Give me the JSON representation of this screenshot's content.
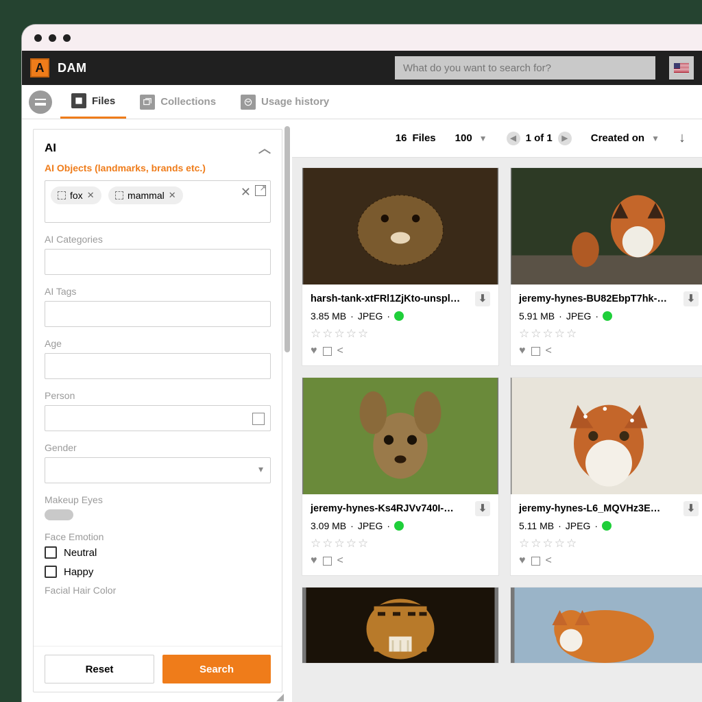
{
  "app": {
    "title": "DAM"
  },
  "search": {
    "placeholder": "What do you want to search for?"
  },
  "tabs": {
    "files": "Files",
    "collections": "Collections",
    "usage": "Usage history"
  },
  "sidebar": {
    "panel_title": "AI",
    "section_title": "AI Objects (landmarks, brands etc.)",
    "chips": [
      {
        "label": "fox"
      },
      {
        "label": "mammal"
      }
    ],
    "labels": {
      "ai_categories": "AI Categories",
      "ai_tags": "AI Tags",
      "age": "Age",
      "person": "Person",
      "gender": "Gender",
      "makeup_eyes": "Makeup Eyes",
      "face_emotion": "Face Emotion",
      "facial_hair": "Facial Hair Color"
    },
    "emotions": {
      "neutral": "Neutral",
      "happy": "Happy"
    },
    "buttons": {
      "reset": "Reset",
      "search": "Search"
    }
  },
  "topbar": {
    "count": "16",
    "count_label": "Files",
    "page_size": "100",
    "pager": "1 of 1",
    "sort": "Created on"
  },
  "files": [
    {
      "name": "harsh-tank-xtFRl1ZjKto-unspl…",
      "size": "3.85 MB",
      "type": "JPEG"
    },
    {
      "name": "jeremy-hynes-BU82EbpT7hk-…",
      "size": "5.91 MB",
      "type": "JPEG"
    },
    {
      "name": "jeremy-hynes-Ks4RJVv740I-…",
      "size": "3.09 MB",
      "type": "JPEG"
    },
    {
      "name": "jeremy-hynes-L6_MQVHz3E…",
      "size": "5.11 MB",
      "type": "JPEG"
    }
  ],
  "colors": {
    "accent": "#ef7c1a",
    "status_ok": "#1fcf3a"
  }
}
